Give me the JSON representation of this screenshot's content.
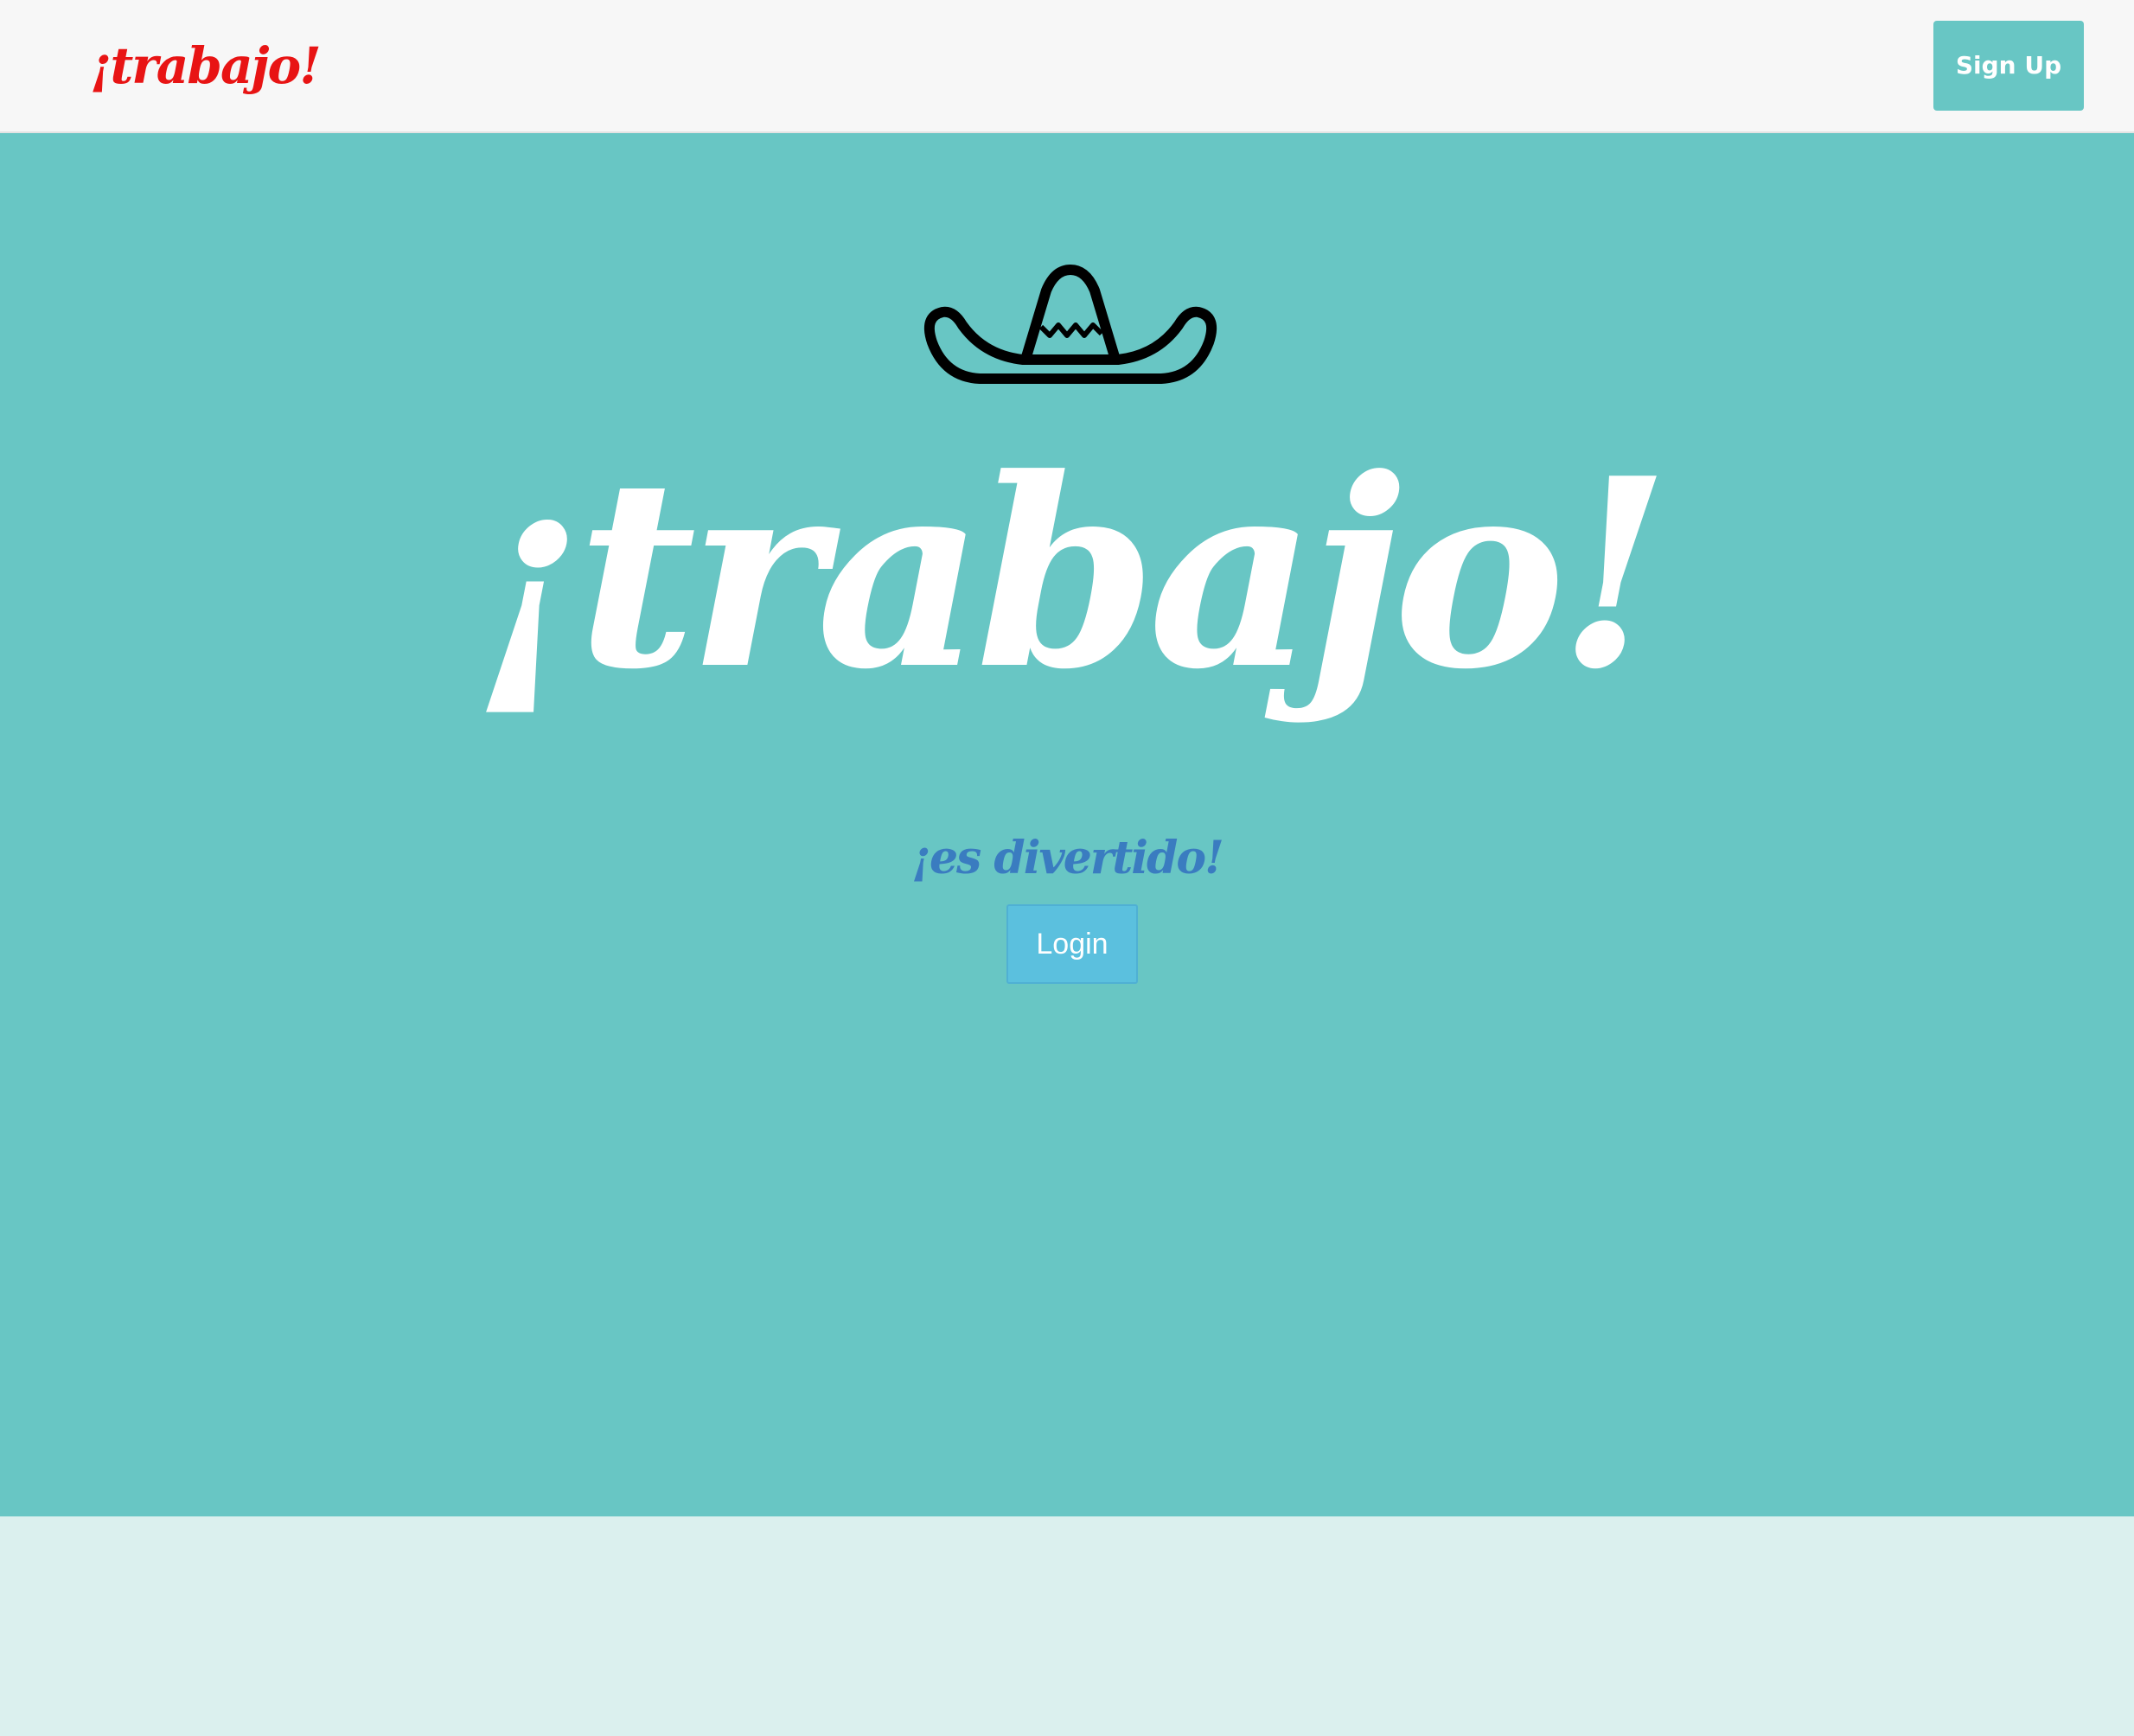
{
  "navbar": {
    "brand": "¡trabajo!",
    "signup_label": "Sign Up"
  },
  "hero": {
    "icon": "sombrero-icon",
    "title": "¡trabajo!",
    "tagline": "¡es divertido!",
    "login_label": "Login"
  },
  "colors": {
    "navbar_bg": "#f7f7f7",
    "brand": "#e81414",
    "accent_teal": "#68c6c4",
    "hero_bg": "#68c6c4",
    "hero_title": "#ffffff",
    "tagline": "#3a7cc0",
    "login_button": "#5bc0de",
    "footer_bg": "#dbf0ee"
  }
}
